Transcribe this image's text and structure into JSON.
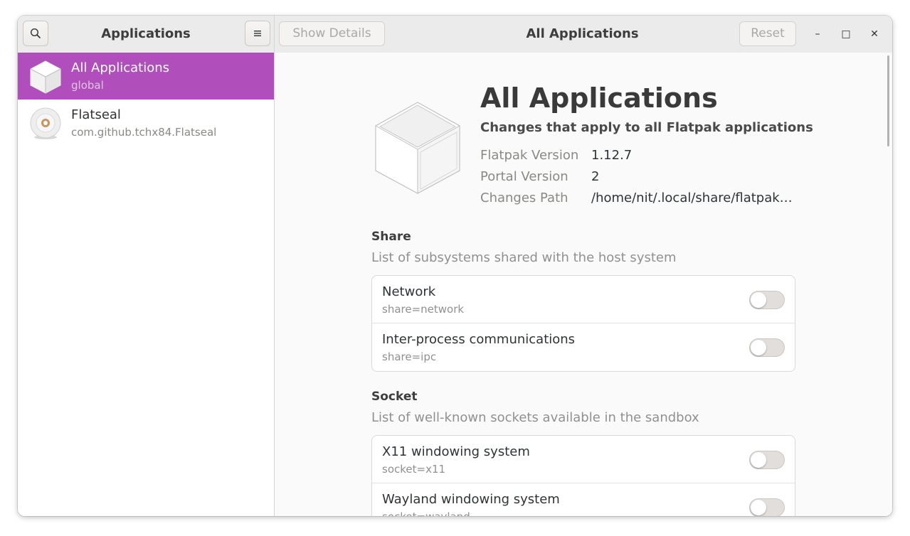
{
  "sidebar_header": {
    "title": "Applications",
    "search_icon": "search-icon",
    "menu_icon": "hamburger-menu-icon"
  },
  "main_header": {
    "show_details_label": "Show Details",
    "title": "All Applications",
    "reset_label": "Reset",
    "minimize_glyph": "–",
    "maximize_glyph": "□",
    "close_glyph": "✕"
  },
  "sidebar": {
    "items": [
      {
        "name": "All Applications",
        "subtitle": "global",
        "icon": "box-icon",
        "selected": true
      },
      {
        "name": "Flatseal",
        "subtitle": "com.github.tchx84.Flatseal",
        "icon": "flatseal-icon",
        "selected": false
      }
    ]
  },
  "details": {
    "title": "All Applications",
    "subtitle": "Changes that apply to all Flatpak applications",
    "rows": [
      {
        "key": "Flatpak Version",
        "value": "1.12.7"
      },
      {
        "key": "Portal Version",
        "value": "2"
      },
      {
        "key": "Changes Path",
        "value": "/home/nit/.local/share/flatpak…"
      }
    ]
  },
  "sections": [
    {
      "title": "Share",
      "description": "List of subsystems shared with the host system",
      "items": [
        {
          "label": "Network",
          "key": "share=network",
          "enabled": false
        },
        {
          "label": "Inter-process communications",
          "key": "share=ipc",
          "enabled": false
        }
      ]
    },
    {
      "title": "Socket",
      "description": "List of well-known sockets available in the sandbox",
      "items": [
        {
          "label": "X11 windowing system",
          "key": "socket=x11",
          "enabled": false
        },
        {
          "label": "Wayland windowing system",
          "key": "socket=wayland",
          "enabled": false
        }
      ]
    }
  ],
  "colors": {
    "accent": "#b04fbc",
    "headerbar": "#ebebeb",
    "background": "#fafafa"
  }
}
